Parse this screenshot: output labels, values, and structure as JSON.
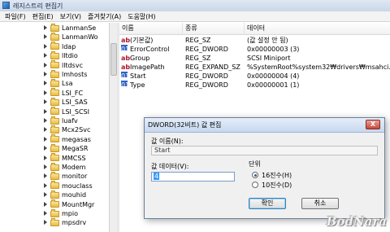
{
  "window": {
    "title": "레지스트리 편집기"
  },
  "menu": [
    "파일(F)",
    "편집(E)",
    "보기(V)",
    "즐겨찾기(A)",
    "도움말(H)"
  ],
  "tree": {
    "items": [
      {
        "label": "LanmanSe"
      },
      {
        "label": "LanmanWo"
      },
      {
        "label": "ldap"
      },
      {
        "label": "lltdio"
      },
      {
        "label": "lltdsvc"
      },
      {
        "label": "lmhosts"
      },
      {
        "label": "Lsa"
      },
      {
        "label": "LSI_FC"
      },
      {
        "label": "LSI_SAS"
      },
      {
        "label": "LSI_SCSI"
      },
      {
        "label": "luafv"
      },
      {
        "label": "Mcx2Svc"
      },
      {
        "label": "megasas"
      },
      {
        "label": "MegaSR"
      },
      {
        "label": "MMCSS"
      },
      {
        "label": "Modem"
      },
      {
        "label": "monitor"
      },
      {
        "label": "mouclass"
      },
      {
        "label": "mouhid"
      },
      {
        "label": "MountMgr"
      },
      {
        "label": "mpio"
      },
      {
        "label": "mpsdrv"
      }
    ]
  },
  "list": {
    "columns": {
      "name": "이름",
      "type": "종류",
      "data": "데이터"
    },
    "rows": [
      {
        "icon": "string-value-icon",
        "name": "(기본값)",
        "type": "REG_SZ",
        "data": "(값 설정 안 됨)"
      },
      {
        "icon": "binary-value-icon",
        "name": "ErrorControl",
        "type": "REG_DWORD",
        "data": "0x00000003 (3)"
      },
      {
        "icon": "string-value-icon",
        "name": "Group",
        "type": "REG_SZ",
        "data": "SCSI Miniport"
      },
      {
        "icon": "string-value-icon",
        "name": "ImagePath",
        "type": "REG_EXPAND_SZ",
        "data": "%SystemRoot%system32₩drivers₩msahci.sys"
      },
      {
        "icon": "binary-value-icon",
        "name": "Start",
        "type": "REG_DWORD",
        "data": "0x00000004 (4)"
      },
      {
        "icon": "binary-value-icon",
        "name": "Type",
        "type": "REG_DWORD",
        "data": "0x00000001 (1)"
      }
    ]
  },
  "dialog": {
    "title": "DWORD(32비트) 값 편집",
    "close_label": "X",
    "value_name_label": "값 이름(N):",
    "value_name": "Start",
    "value_data_label": "값 데이터(V):",
    "value_data": "4",
    "base_label": "단위",
    "hex_label": "16진수(H)",
    "dec_label": "10진수(D)",
    "selected_base": "hex",
    "ok_label": "확인",
    "cancel_label": "취소"
  },
  "watermark": "BodNara"
}
